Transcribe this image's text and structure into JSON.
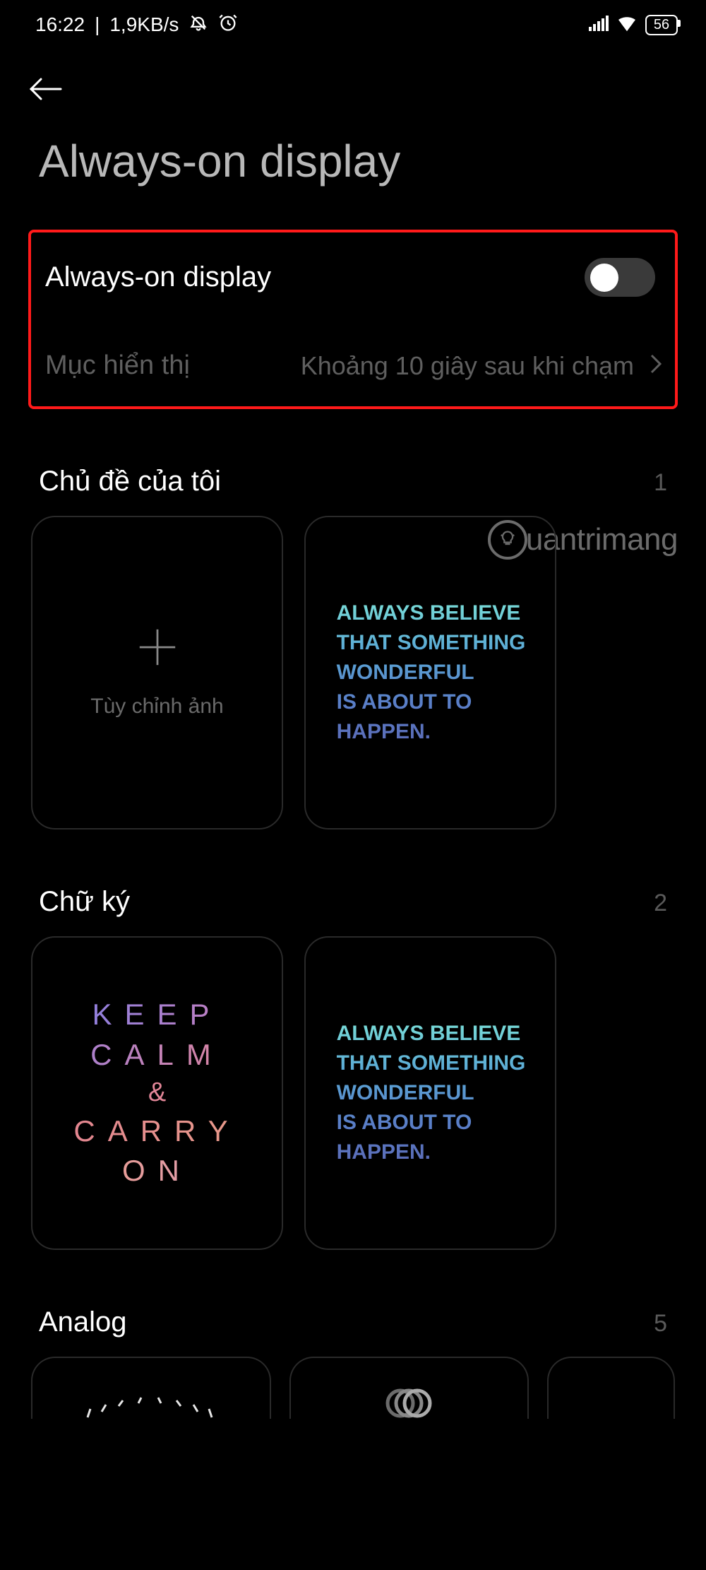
{
  "statusbar": {
    "time": "16:22",
    "speed": "1,9KB/s",
    "battery": "56"
  },
  "page": {
    "title": "Always-on display"
  },
  "panel": {
    "toggle_label": "Always-on display",
    "toggle_on": false,
    "display_items_label": "Mục hiển thị",
    "display_items_value": "Khoảng 10 giây sau khi chạm"
  },
  "watermark": {
    "text": "uantrimang"
  },
  "sections": {
    "mythemes": {
      "title": "Chủ đề của tôi",
      "count": "1",
      "custom_label": "Tùy chỉnh ảnh",
      "quote": "ALWAYS BELIEVE\nTHAT SOMETHING\nWONDERFUL\nIS ABOUT TO\nHAPPEN."
    },
    "signature": {
      "title": "Chữ ký",
      "count": "2",
      "keepcalm_lines": [
        "KEEP",
        "CALM",
        "&",
        "CARRY",
        "ON"
      ],
      "quote": "ALWAYS BELIEVE\nTHAT SOMETHING\nWONDERFUL\nIS ABOUT TO\nHAPPEN."
    },
    "analog": {
      "title": "Analog",
      "count": "5"
    }
  }
}
